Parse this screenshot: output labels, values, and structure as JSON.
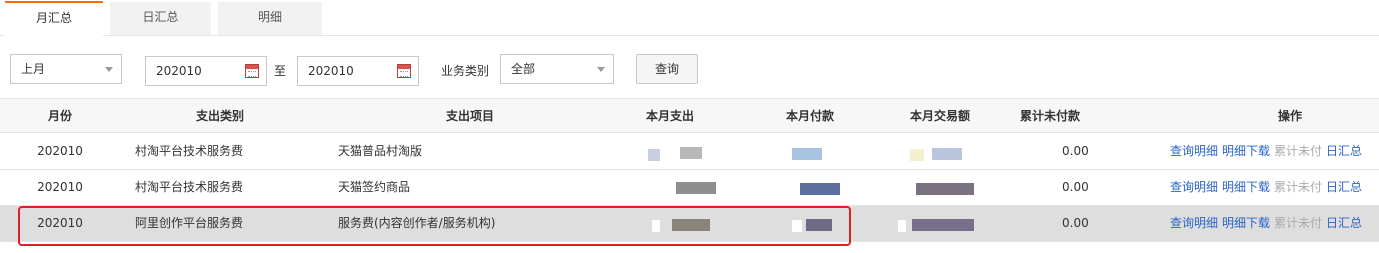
{
  "tabs": [
    {
      "label": "月汇总",
      "active": true
    },
    {
      "label": "日汇总",
      "active": false
    },
    {
      "label": "明细",
      "active": false
    }
  ],
  "filter": {
    "period_select": "上月",
    "date_from": "202010",
    "to_label": "至",
    "date_to": "202010",
    "category_label": "业务类别",
    "category_select": "全部",
    "query_button": "查询"
  },
  "table": {
    "headers": [
      "月份",
      "支出类别",
      "支出项目",
      "本月支出",
      "本月付款",
      "本月交易额",
      "累计未付款",
      "操作"
    ],
    "rows": [
      {
        "month": "202010",
        "category": "村淘平台技术服务费",
        "item": "天猫普品村淘版",
        "unpaid": "0.00"
      },
      {
        "month": "202010",
        "category": "村淘平台技术服务费",
        "item": "天猫签约商品",
        "unpaid": "0.00"
      },
      {
        "month": "202010",
        "category": "阿里创作平台服务费",
        "item": "服务费(内容创作者/服务机构)",
        "unpaid": "0.00"
      }
    ],
    "actions": {
      "detail": "查询明细",
      "download": "明细下载",
      "cumulative_unpaid": "累计未付",
      "daily": "日汇总"
    }
  },
  "colors": {
    "accent": "#ff6a00",
    "link": "#2b64c7",
    "highlight": "#e02020"
  }
}
